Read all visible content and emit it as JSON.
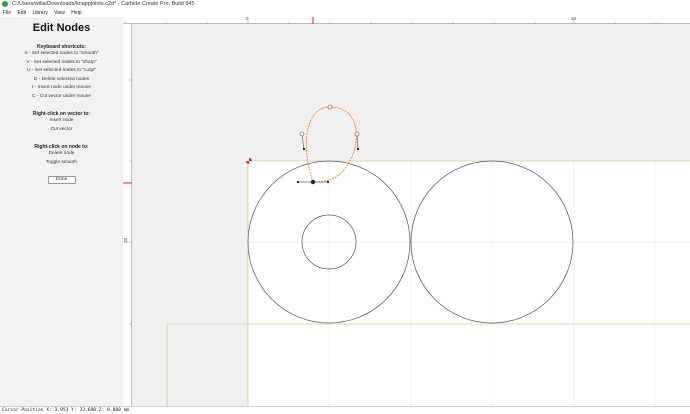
{
  "window": {
    "title": "C:/Users/willa/Downloads/knappjoints.c2d* - Carbide Create Pro, Build 845"
  },
  "menu": {
    "items": [
      "File",
      "Edit",
      "Library",
      "View",
      "Help"
    ]
  },
  "panel": {
    "title": "Edit Nodes",
    "shortcuts_heading": "Keyboard shortcuts:",
    "shortcuts": [
      "S - Set selected nodes to \"smooth\"",
      "V - Set selected nodes to \"sharp\"",
      "U - Set selected nodes to \"cusp\"",
      "D - Delete selected nodes",
      "I - Insert node under mouse",
      "C - Cut vector under mouse"
    ],
    "vector_heading": "Right-click on vector to:",
    "vector_actions": [
      "Insert node",
      "Cut vector"
    ],
    "node_heading": "Right-click on node to:",
    "node_actions": [
      "Delete node",
      "Toggle smooth"
    ],
    "done_label": "Done"
  },
  "rulers": {
    "h_labels": [
      "0",
      "10"
    ],
    "v_labels": [
      "20"
    ]
  },
  "status": {
    "cursor_text": "Cursor Position X: 3.953 Y: 23.690 Z: 0.000 mm"
  },
  "colors": {
    "selected_path": "#f07a1a",
    "stock_outline": "#b8c47a",
    "circle_stroke": "#555555",
    "ruler_marker": "#e02020",
    "origin_marker": "#e02020"
  }
}
